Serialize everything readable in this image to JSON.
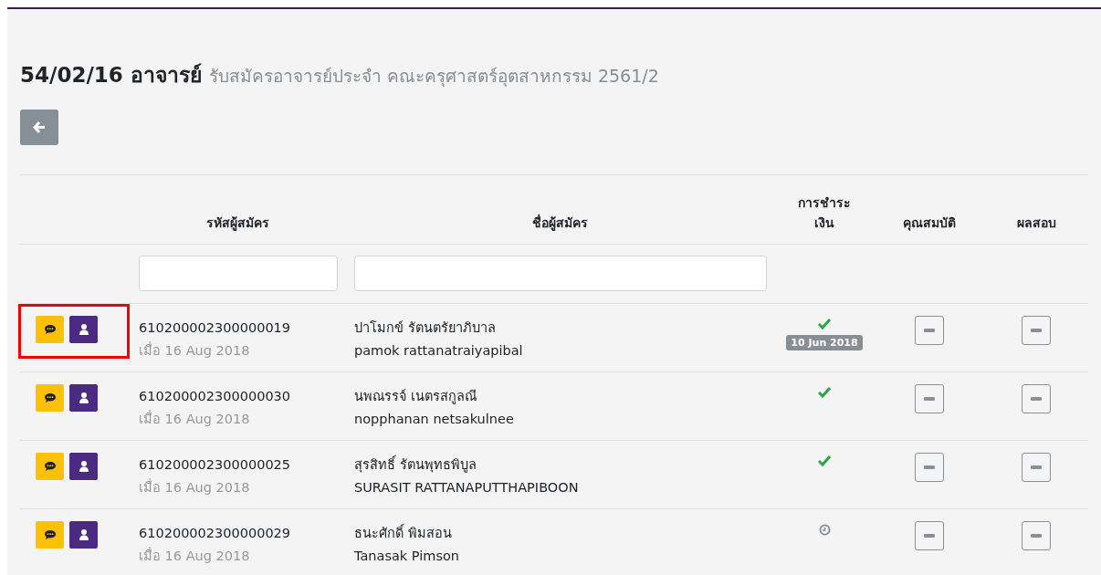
{
  "title": {
    "main": "54/02/16 อาจารย์",
    "subtitle": "รับสมัครอาจารย์ประจำ คณะครุศาสตร์อุตสาหกรรม 2561/2"
  },
  "table": {
    "columns": [
      {
        "filter": false
      },
      {
        "label": "รหัสผู้สมัคร",
        "filter": true
      },
      {
        "label": "ชื่อผู้สมัคร",
        "filter": true
      },
      {
        "label": "การชำระ เงิน",
        "filter": false
      },
      {
        "label": "คุณสมบัติ",
        "filter": false
      },
      {
        "label": "ผลสอบ",
        "filter": false
      }
    ],
    "rows": [
      {
        "highlighted": true,
        "code": "610200002300000019",
        "date": "เมื่อ 16 Aug 2018",
        "name_th": "ปาโมกข์ รัตนตรัยาภิบาล",
        "name_en": "pamok rattanatraiyapibal",
        "payment": {
          "kind": "paid",
          "date": "10 Jun 2018"
        }
      },
      {
        "highlighted": false,
        "code": "610200002300000030",
        "date": "เมื่อ 16 Aug 2018",
        "name_th": "นพณรรจ์ เนตรสกูลณี",
        "name_en": "nopphanan netsakulnee",
        "payment": {
          "kind": "paid"
        }
      },
      {
        "highlighted": false,
        "code": "610200002300000025",
        "date": "เมื่อ 16 Aug 2018",
        "name_th": "สุรสิทธิ์ รัตนพุทธพิบูล",
        "name_en": "SURASIT RATTANAPUTTHAPIBOON",
        "payment": {
          "kind": "paid"
        }
      },
      {
        "highlighted": false,
        "code": "610200002300000029",
        "date": "เมื่อ 16 Aug 2018",
        "name_th": "ธนะศักดิ์ พิมสอน",
        "name_en": "Tanasak Pimson",
        "payment": {
          "kind": "pending"
        }
      }
    ]
  }
}
